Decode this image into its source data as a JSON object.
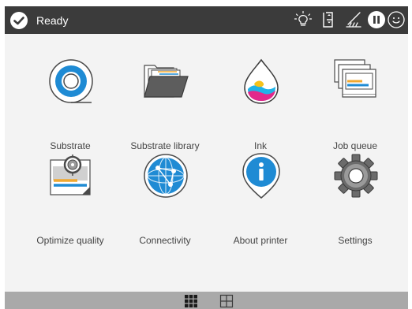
{
  "status": {
    "text": "Ready"
  },
  "topbar": {
    "icons": [
      "lightbulb-icon",
      "cartridge-door-icon",
      "maintenance-icon",
      "pause-icon",
      "smiley-icon"
    ]
  },
  "tiles": [
    {
      "label": "Substrate",
      "icon": "substrate-roll-icon"
    },
    {
      "label": "Substrate library",
      "icon": "folder-library-icon"
    },
    {
      "label": "Ink",
      "icon": "ink-drop-icon"
    },
    {
      "label": "Job queue",
      "icon": "job-queue-icon"
    },
    {
      "label": "Optimize quality",
      "icon": "optimize-quality-icon"
    },
    {
      "label": "Connectivity",
      "icon": "globe-network-icon"
    },
    {
      "label": "About printer",
      "icon": "info-pin-icon"
    },
    {
      "label": "Settings",
      "icon": "gear-icon"
    }
  ],
  "pages": {
    "count": 2,
    "active": 1
  },
  "colors": {
    "topbar": "#3b3b3b",
    "bottombar": "#a9a9a9",
    "accent_blue": "#1e88d0",
    "background": "#f3f3f3"
  }
}
